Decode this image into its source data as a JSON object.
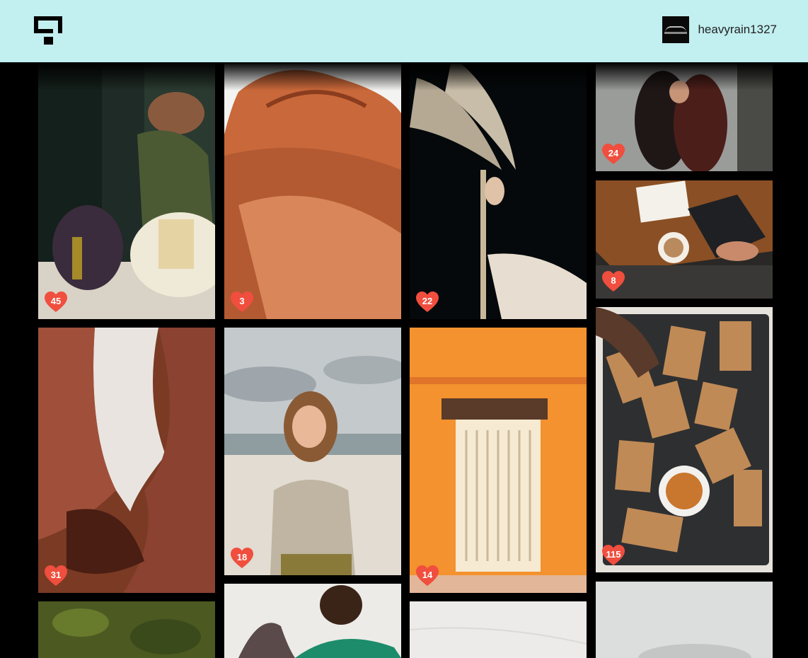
{
  "header": {
    "username": "heavyrain1327",
    "background": "#c2eff0"
  },
  "tiles": [
    {
      "name": "photo-woman-groceries",
      "likes": "45"
    },
    {
      "name": "photo-canyon-rock",
      "likes": "3"
    },
    {
      "name": "photo-pampas-grass",
      "likes": "22"
    },
    {
      "name": "photo-couple-window",
      "likes": "24"
    },
    {
      "name": "photo-coffee-laptop",
      "likes": "8"
    },
    {
      "name": "photo-slot-canyon",
      "likes": "31"
    },
    {
      "name": "photo-woman-beach",
      "likes": "18"
    },
    {
      "name": "photo-orange-door",
      "likes": "14"
    },
    {
      "name": "photo-crackers-tray",
      "likes": "115"
    },
    {
      "name": "photo-aerial-forest",
      "likes": ""
    },
    {
      "name": "photo-woman-green-shirt",
      "likes": ""
    },
    {
      "name": "photo-white-marble",
      "likes": ""
    },
    {
      "name": "photo-misty-landscape",
      "likes": ""
    }
  ],
  "colors": {
    "accent_heart": "#f04e3e"
  }
}
